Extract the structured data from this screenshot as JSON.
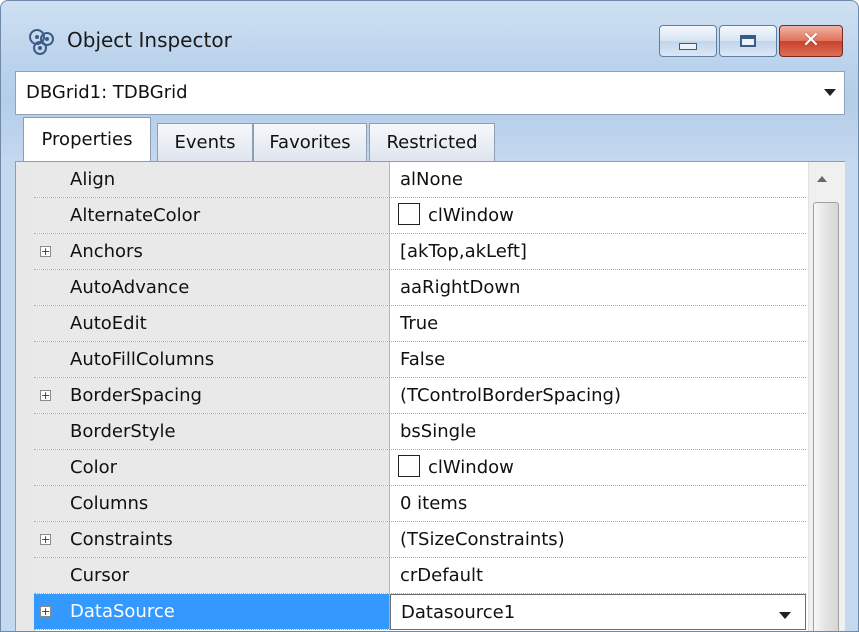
{
  "window": {
    "title": "Object Inspector",
    "close_glyph": "✕"
  },
  "component_selector": {
    "value": "DBGrid1: TDBGrid"
  },
  "tabs": [
    {
      "label": "Properties",
      "active": true
    },
    {
      "label": "Events",
      "active": false
    },
    {
      "label": "Favorites",
      "active": false
    },
    {
      "label": "Restricted",
      "active": false
    }
  ],
  "properties": [
    {
      "name": "Align",
      "value": "alNone"
    },
    {
      "name": "AlternateColor",
      "value": "clWindow",
      "swatch_color": "#ffffff"
    },
    {
      "name": "Anchors",
      "value": "[akTop,akLeft]",
      "expandable": true
    },
    {
      "name": "AutoAdvance",
      "value": "aaRightDown"
    },
    {
      "name": "AutoEdit",
      "value": "True"
    },
    {
      "name": "AutoFillColumns",
      "value": "False"
    },
    {
      "name": "BorderSpacing",
      "value": "(TControlBorderSpacing)",
      "expandable": true
    },
    {
      "name": "BorderStyle",
      "value": "bsSingle"
    },
    {
      "name": "Color",
      "value": "clWindow",
      "swatch_color": "#ffffff"
    },
    {
      "name": "Columns",
      "value": "0 items"
    },
    {
      "name": "Constraints",
      "value": "(TSizeConstraints)",
      "expandable": true
    },
    {
      "name": "Cursor",
      "value": "crDefault"
    },
    {
      "name": "DataSource",
      "value": "Datasource1",
      "expandable": true,
      "selected": true
    }
  ],
  "expander_glyph": "+",
  "icons": {
    "app": "object-inspector-icon",
    "minimize": "minimize-icon",
    "maximize": "maximize-icon",
    "close": "close-icon"
  },
  "colors": {
    "selection": "#3399ff",
    "close_button": "#c9412a"
  }
}
